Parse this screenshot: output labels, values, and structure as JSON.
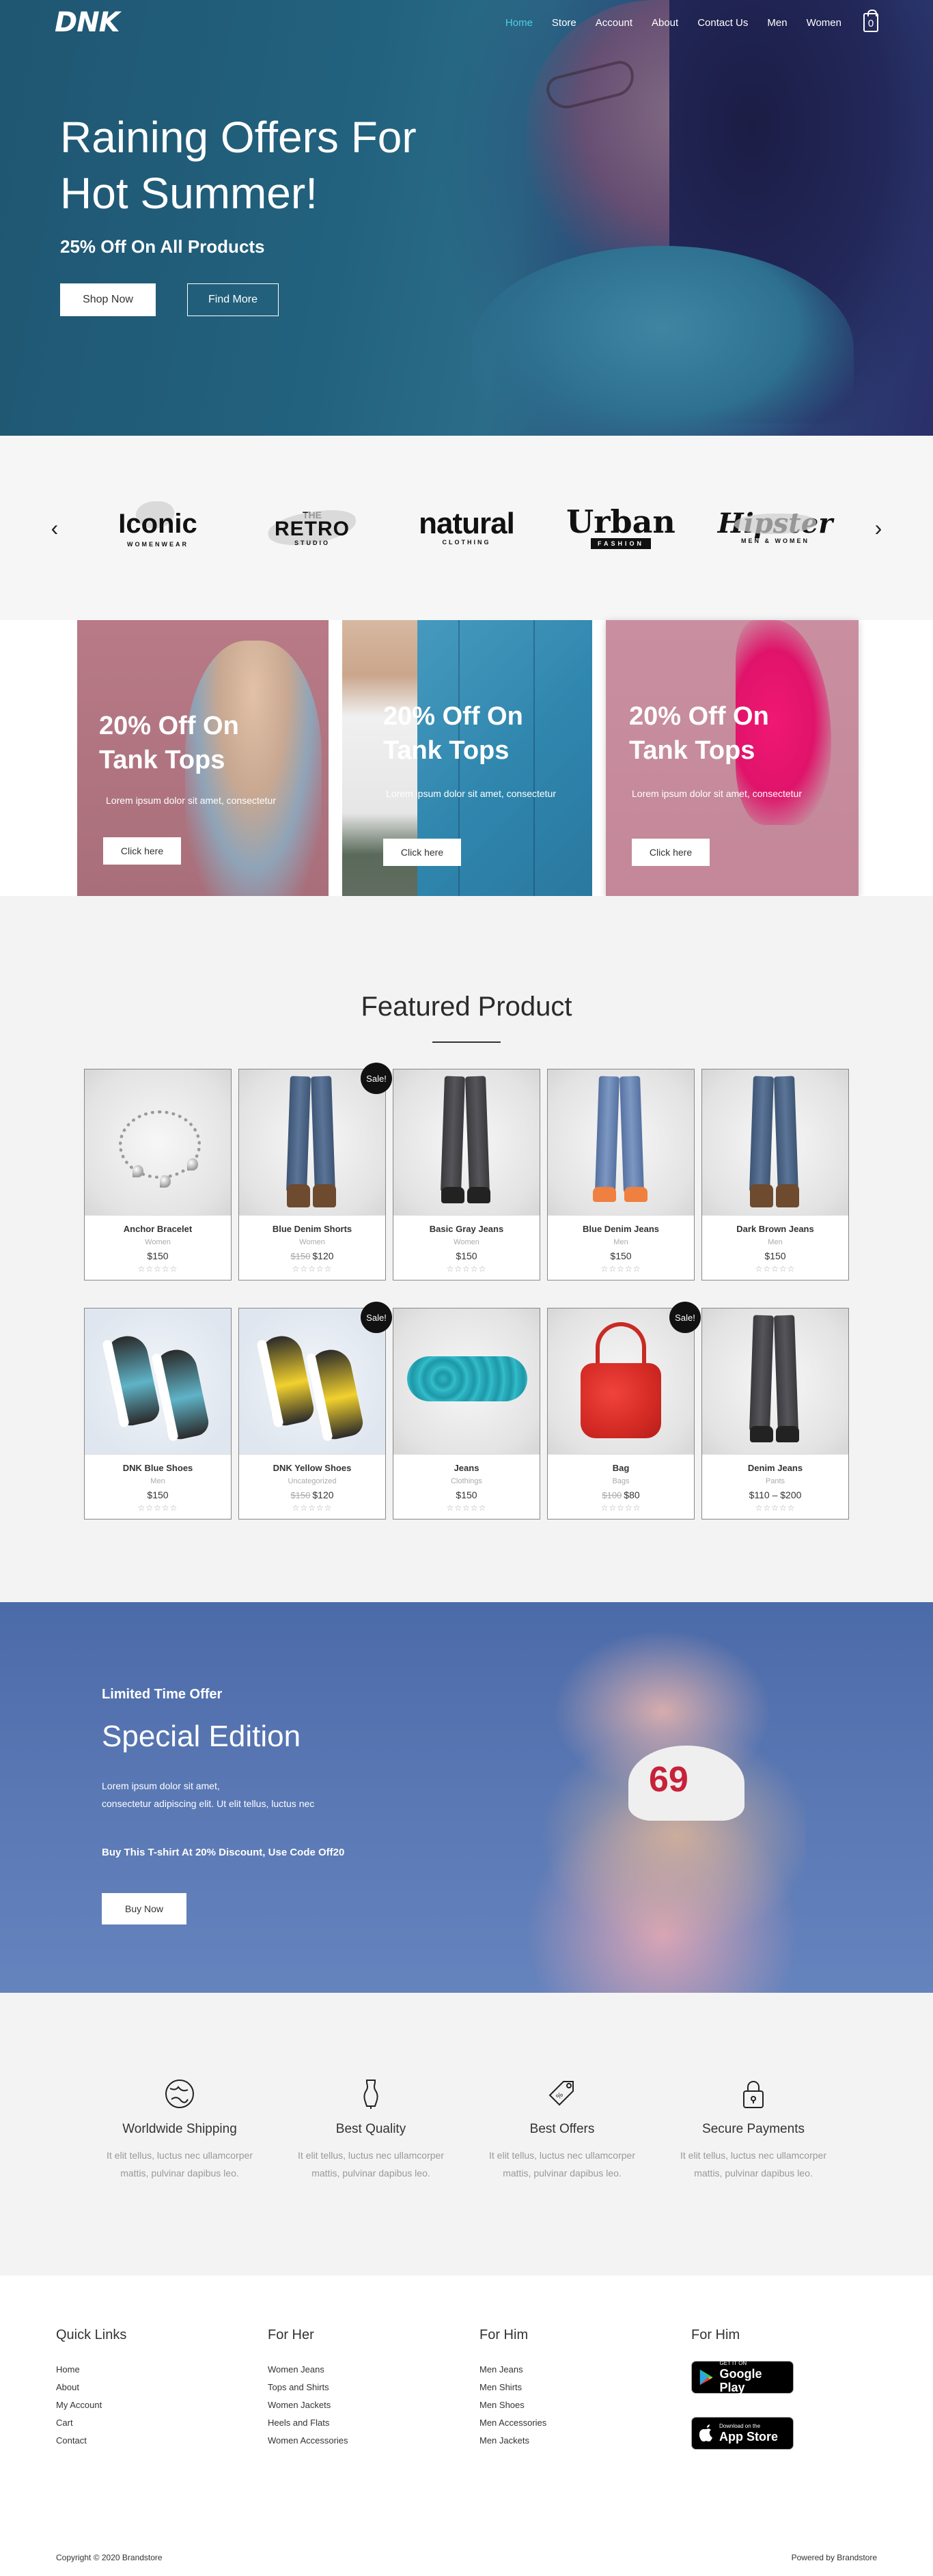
{
  "nav": {
    "logo": "DNK",
    "items": [
      "Home",
      "Store",
      "Account",
      "About",
      "Contact Us",
      "Men",
      "Women"
    ],
    "cart_count": "0"
  },
  "hero": {
    "title_line1": "Raining Offers For",
    "title_line2": "Hot Summer!",
    "subtitle": "25% Off On All Products",
    "btn_primary": "Shop Now",
    "btn_secondary": "Find More"
  },
  "brands": {
    "prev_icon": "chevron-left-icon",
    "next_icon": "chevron-right-icon",
    "iconic": {
      "name": "Iconic",
      "sub": "WOMENWEAR"
    },
    "retro": {
      "the": "THE",
      "name": "RETRO",
      "sub": "STUDIO"
    },
    "natural": {
      "name": "natural",
      "sub": "CLOTHING"
    },
    "urban": {
      "name": "Urban",
      "sub": "FASHION"
    },
    "hipster": {
      "name": "Hipster",
      "sub": "MEN & WOMEN"
    }
  },
  "promos": [
    {
      "title1": "20% Off On",
      "title2": "Tank Tops",
      "text": "Lorem ipsum dolor sit amet, consectetur",
      "button": "Click here"
    },
    {
      "title1": "20% Off On",
      "title2": "Tank Tops",
      "text": "Lorem ipsum dolor sit amet, consectetur",
      "button": "Click here"
    },
    {
      "title1": "20% Off On",
      "title2": "Tank Tops",
      "text": "Lorem ipsum dolor sit amet, consectetur",
      "button": "Click here"
    }
  ],
  "featured": {
    "title": "Featured Product",
    "sale_label": "Sale!",
    "stars": "☆☆☆☆☆",
    "products": [
      {
        "name": "Anchor Bracelet",
        "cat": "Women",
        "price": "$150",
        "old": ""
      },
      {
        "name": "Blue Denim Shorts",
        "cat": "Women",
        "price": "$120",
        "old": "$150"
      },
      {
        "name": "Basic Gray Jeans",
        "cat": "Women",
        "price": "$150",
        "old": ""
      },
      {
        "name": "Blue Denim Jeans",
        "cat": "Men",
        "price": "$150",
        "old": ""
      },
      {
        "name": "Dark Brown Jeans",
        "cat": "Men",
        "price": "$150",
        "old": ""
      },
      {
        "name": "DNK Blue Shoes",
        "cat": "Men",
        "price": "$150",
        "old": ""
      },
      {
        "name": "DNK Yellow Shoes",
        "cat": "Uncategorized",
        "price": "$120",
        "old": "$150"
      },
      {
        "name": "Jeans",
        "cat": "Clothings",
        "price": "$150",
        "old": ""
      },
      {
        "name": "Bag",
        "cat": "Bags",
        "price": "$80",
        "old": "$100"
      },
      {
        "name": "Denim Jeans",
        "cat": "Pants",
        "price": "$110 – $200",
        "old": ""
      }
    ]
  },
  "special": {
    "label": "Limited Time Offer",
    "title": "Special Edition",
    "desc_line1": "Lorem ipsum dolor sit amet,",
    "desc_line2": "consectetur adipiscing elit. Ut elit tellus, luctus nec",
    "code": "Buy This T-shirt At 20% Discount, Use Code Off20",
    "button": "Buy Now",
    "cap_number": "69"
  },
  "features": [
    {
      "icon": "globe-icon",
      "title": "Worldwide Shipping",
      "text": "It elit tellus, luctus nec ullamcorper mattis, pulvinar dapibus leo."
    },
    {
      "icon": "mannequin-icon",
      "title": "Best Quality",
      "text": "It elit tellus, luctus nec ullamcorper mattis, pulvinar dapibus leo."
    },
    {
      "icon": "price-tag-icon",
      "title": "Best Offers",
      "text": "It elit tellus, luctus nec ullamcorper mattis, pulvinar dapibus leo."
    },
    {
      "icon": "lock-icon",
      "title": "Secure Payments",
      "text": "It elit tellus, luctus nec ullamcorper mattis, pulvinar dapibus leo."
    }
  ],
  "footer": {
    "quick": {
      "title": "Quick Links",
      "links": [
        "Home",
        "About",
        "My Account",
        "Cart",
        "Contact"
      ]
    },
    "her": {
      "title": "For Her",
      "links": [
        "Women Jeans",
        "Tops and Shirts",
        "Women Jackets",
        "Heels and Flats",
        "Women Accessories"
      ]
    },
    "him": {
      "title": "For Him",
      "links": [
        "Men Jeans",
        "Men Shirts",
        "Men Shoes",
        "Men Accessories",
        "Men Jackets"
      ]
    },
    "apps": {
      "title": "For Him",
      "google_small": "GET IT ON",
      "google_big": "Google Play",
      "apple_small": "Download on the",
      "apple_big": "App Store"
    },
    "copyright": "Copyright © 2020 Brandstore",
    "powered": "Powered by Brandstore"
  }
}
